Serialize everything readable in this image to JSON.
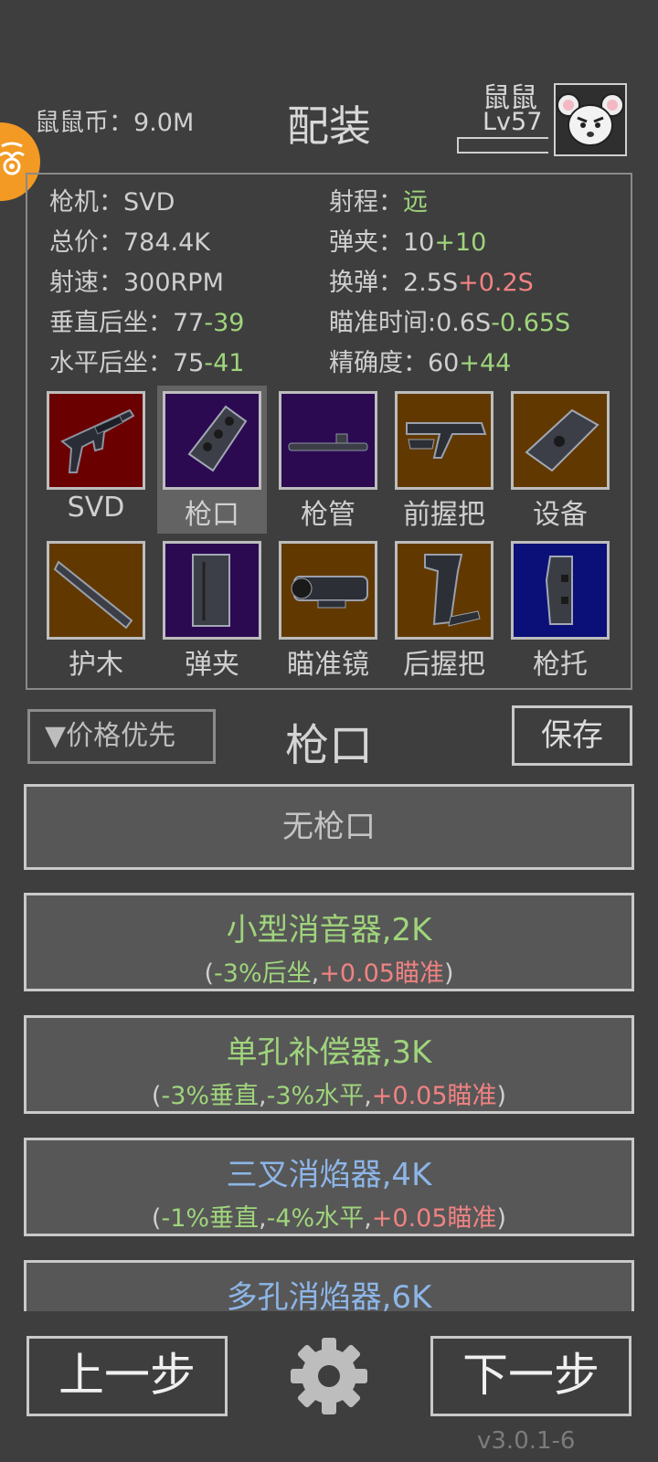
{
  "header": {
    "coin_label": "鼠鼠币：",
    "coin_value": "9.0M",
    "title": "配装",
    "profile_name": "鼠鼠",
    "profile_level": "Lv57"
  },
  "stats": {
    "gun_label": "枪机：",
    "gun_value": "SVD",
    "price_label": "总价：",
    "price_value": "784.4K",
    "rate_label": "射速：",
    "rate_value": "300RPM",
    "vrecoil_label": "垂直后坐：",
    "vrecoil_base": "77",
    "vrecoil_mod": "-39",
    "hrecoil_label": "水平后坐：",
    "hrecoil_base": "75",
    "hrecoil_mod": "-41",
    "range_label": "射程：",
    "range_value": "远",
    "mag_label": "弹夹：",
    "mag_base": "10",
    "mag_mod": "+10",
    "reload_label": "换弹：",
    "reload_base": "2.5S",
    "reload_mod": "+0.2S",
    "aim_label": "瞄准时间:",
    "aim_base": "0.6S",
    "aim_mod": "-0.65S",
    "acc_label": "精确度：",
    "acc_base": "60",
    "acc_mod": "+44"
  },
  "slots": [
    {
      "label": "SVD",
      "color": "#6b0000",
      "icon": "rifle-icon"
    },
    {
      "label": "枪口",
      "color": "#2c0a52",
      "icon": "muzzle-icon",
      "selected": true
    },
    {
      "label": "枪管",
      "color": "#2c0a52",
      "icon": "barrel-icon"
    },
    {
      "label": "前握把",
      "color": "#613900",
      "icon": "foregrip-icon"
    },
    {
      "label": "设备",
      "color": "#613900",
      "icon": "device-icon"
    },
    {
      "label": "护木",
      "color": "#613900",
      "icon": "handguard-icon"
    },
    {
      "label": "弹夹",
      "color": "#2c0a52",
      "icon": "magazine-icon"
    },
    {
      "label": "瞄准镜",
      "color": "#613900",
      "icon": "scope-icon"
    },
    {
      "label": "后握把",
      "color": "#613900",
      "icon": "pistol-grip-icon"
    },
    {
      "label": "枪托",
      "color": "#0a1078",
      "icon": "stock-icon"
    }
  ],
  "controls": {
    "sort_label": "▼价格优先",
    "section_title": "枪口",
    "save_label": "保存"
  },
  "options": [
    {
      "name": "无枪口"
    },
    {
      "name": "小型消音器,2K",
      "desc": [
        "-3%后坐",
        "+0.05瞄准"
      ]
    },
    {
      "name": "单孔补偿器,3K",
      "desc": [
        "-3%垂直",
        "-3%水平",
        "+0.05瞄准"
      ]
    },
    {
      "name": "三叉消焰器,4K",
      "desc": [
        "-1%垂直",
        "-4%水平",
        "+0.05瞄准"
      ]
    },
    {
      "name": "多孔消焰器,6K"
    }
  ],
  "footer": {
    "prev_label": "上一步",
    "next_label": "下一步",
    "version": "v3.0.1-6"
  },
  "colors": {
    "background": "#3e3e3e",
    "positive": "#9fd47c",
    "negative": "#f08282",
    "accent_badge": "#f29a24"
  }
}
